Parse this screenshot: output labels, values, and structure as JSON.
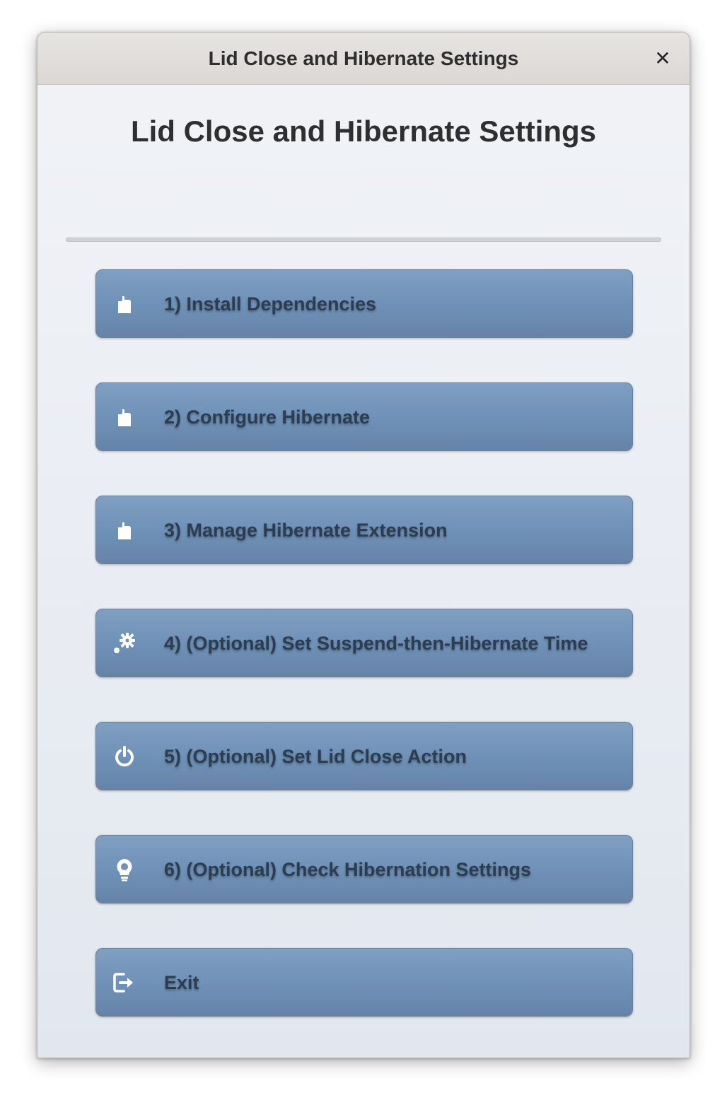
{
  "window": {
    "title": "Lid Close and Hibernate Settings",
    "close_label": "✕"
  },
  "main": {
    "heading": "Lid Close and Hibernate Settings",
    "buttons": [
      {
        "label": "1) Install Dependencies",
        "icon": "document-icon"
      },
      {
        "label": "2) Configure Hibernate",
        "icon": "document-icon"
      },
      {
        "label": "3) Manage Hibernate Extension",
        "icon": "document-icon"
      },
      {
        "label": "4) (Optional) Set Suspend-then-Hibernate Time",
        "icon": "gear-icon"
      },
      {
        "label": "5) (Optional) Set Lid Close Action",
        "icon": "power-icon"
      },
      {
        "label": "6) (Optional) Check Hibernation Settings",
        "icon": "lightbulb-icon"
      },
      {
        "label": "Exit",
        "icon": "exit-icon"
      }
    ]
  },
  "colors": {
    "button_top": "#7f9fc2",
    "button_bottom": "#6583a7",
    "button_text": "#2c3d52",
    "window_bg": "#e9edf3",
    "titlebar_bg": "#e0ddda"
  }
}
